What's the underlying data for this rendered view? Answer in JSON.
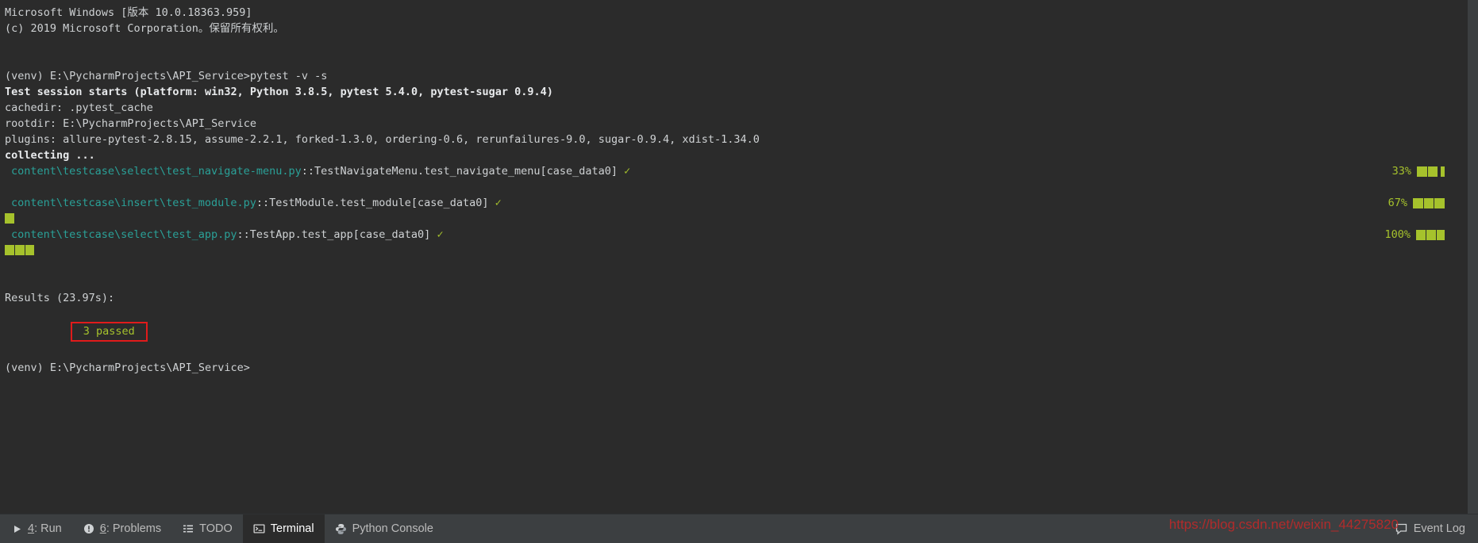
{
  "terminal": {
    "lines": [
      {
        "text": "Microsoft Windows [版本 10.0.18363.959]"
      },
      {
        "text": "(c) 2019 Microsoft Corporation。保留所有权利。"
      },
      {
        "text": ""
      },
      {
        "text": ""
      },
      {
        "text": "(venv) E:\\PycharmProjects\\API_Service>pytest -v -s"
      },
      {
        "text": "Test session starts (platform: win32, Python 3.8.5, pytest 5.4.0, pytest-sugar 0.9.4)"
      },
      {
        "text": "cachedir: .pytest_cache"
      },
      {
        "text": "rootdir: E:\\PycharmProjects\\API_Service"
      },
      {
        "text": "plugins: allure-pytest-2.8.15, assume-2.2.1, forked-1.3.0, ordering-0.6, rerunfailures-9.0, sugar-0.9.4, xdist-1.34.0"
      },
      {
        "text": "collecting ..."
      }
    ],
    "tests": [
      {
        "path": "content\\testcase\\select\\test_navigate-menu.py",
        "node": "::TestNavigateMenu.test_navigate_menu[case_data0]",
        "check": "✓",
        "percent": "33%"
      },
      {
        "path": "content\\testcase\\insert\\test_module.py",
        "node": "::TestModule.test_module[case_data0]",
        "check": "✓",
        "percent": "67%"
      },
      {
        "path": "content\\testcase\\select\\test_app.py",
        "node": "::TestApp.test_app[case_data0]",
        "check": "✓",
        "percent": "100%"
      }
    ],
    "results_label": "Results (23.97s):",
    "results_value": "3 passed",
    "prompt_final": "(venv) E:\\PycharmProjects\\API_Service>",
    "colors": {
      "background": "#2b2b2b",
      "foreground": "#cfd2d4",
      "path": "#2aa198",
      "progress": "#a6c22c",
      "highlight_box": "#e01b1b"
    }
  },
  "statusbar": {
    "tabs": [
      {
        "mnemonic": "4",
        "label": ": Run",
        "icon": "play-icon",
        "active": false
      },
      {
        "mnemonic": "6",
        "label": ": Problems",
        "icon": "warning-icon",
        "active": false
      },
      {
        "mnemonic": "",
        "label": "TODO",
        "icon": "list-icon",
        "active": false
      },
      {
        "mnemonic": "",
        "label": "Terminal",
        "icon": "terminal-icon",
        "active": true
      },
      {
        "mnemonic": "",
        "label": "Python Console",
        "icon": "python-icon",
        "active": false
      }
    ],
    "event_log": {
      "label": "Event Log",
      "icon": "event-log-icon"
    }
  },
  "watermark": {
    "text": "https://blog.csdn.net/weixin_44275820"
  }
}
